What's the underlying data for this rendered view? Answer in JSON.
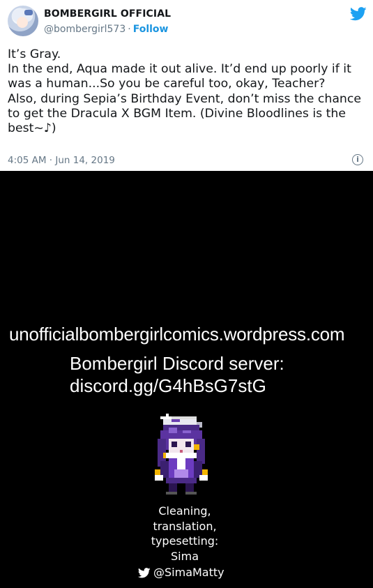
{
  "tweet": {
    "display_name": "BOMBERGIRL OFFICIAL",
    "handle": "@bombergirl573",
    "separator": "·",
    "follow_label": "Follow",
    "body_lines": [
      "It’s Gray.",
      "In the end, Aqua made it out alive. It’d end up poorly if it",
      "was a human...So you be careful too, okay, Teacher?",
      "Also, during Sepia’s Birthday Event, don’t miss the chance",
      "to get the Dracula X BGM Item. (Divine Bloodlines is the",
      "best~♪)"
    ],
    "timestamp": "4:05 AM · Jun 14, 2019",
    "info_glyph": "i",
    "accent_color": "#1da1f2",
    "icons": [
      "avatar",
      "twitter-bird-icon",
      "info-icon"
    ]
  },
  "credits": {
    "site_url": "unofficialbombergirlcomics.wordpress.com",
    "discord_label": "Bombergirl Discord server:",
    "discord_link": "discord.gg/G4hBsG7stG",
    "staff_lines": [
      "Cleaning,",
      "translation,",
      "typesetting:",
      "Sima"
    ],
    "staff_handle": "@SimaMatty",
    "icons": [
      "pixel-character-sprite",
      "twitter-bird-icon"
    ]
  }
}
